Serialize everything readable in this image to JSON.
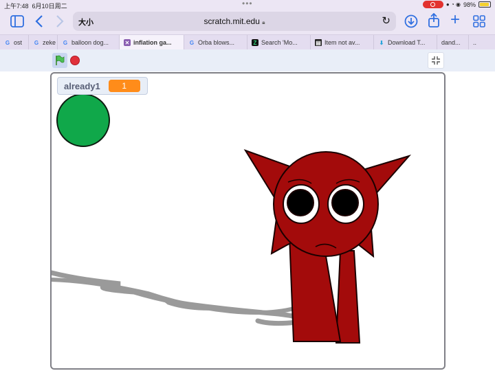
{
  "status": {
    "time": "上午7:48",
    "date": "6月10日周二",
    "battery": "98%"
  },
  "browser": {
    "text_size": "大小",
    "url": "scratch.mit.edu",
    "tabs": [
      {
        "label": "ost",
        "favicon": "google-icon"
      },
      {
        "label": "zeke",
        "favicon": "google-icon"
      },
      {
        "label": "balloon dog...",
        "favicon": "google-icon"
      },
      {
        "label": "inflation ga...",
        "favicon": "scratch-icon",
        "active": true
      },
      {
        "label": "Orba blows...",
        "favicon": "google-icon"
      },
      {
        "label": "Search 'Mo...",
        "favicon": "site-icon"
      },
      {
        "label": "Item not av...",
        "favicon": "page-icon"
      },
      {
        "label": "Download T...",
        "favicon": "download-icon"
      },
      {
        "label": "dand...",
        "favicon": "none"
      },
      {
        "label": "..",
        "favicon": "none"
      }
    ]
  },
  "project": {
    "variable_monitor": {
      "name": "already1",
      "value": "1"
    }
  },
  "colors": {
    "character_red": "#a30b0b",
    "green_circle": "#10a84a",
    "scribble_gray": "#9a9a9a",
    "monitor_orange": "#ff8c1a"
  }
}
